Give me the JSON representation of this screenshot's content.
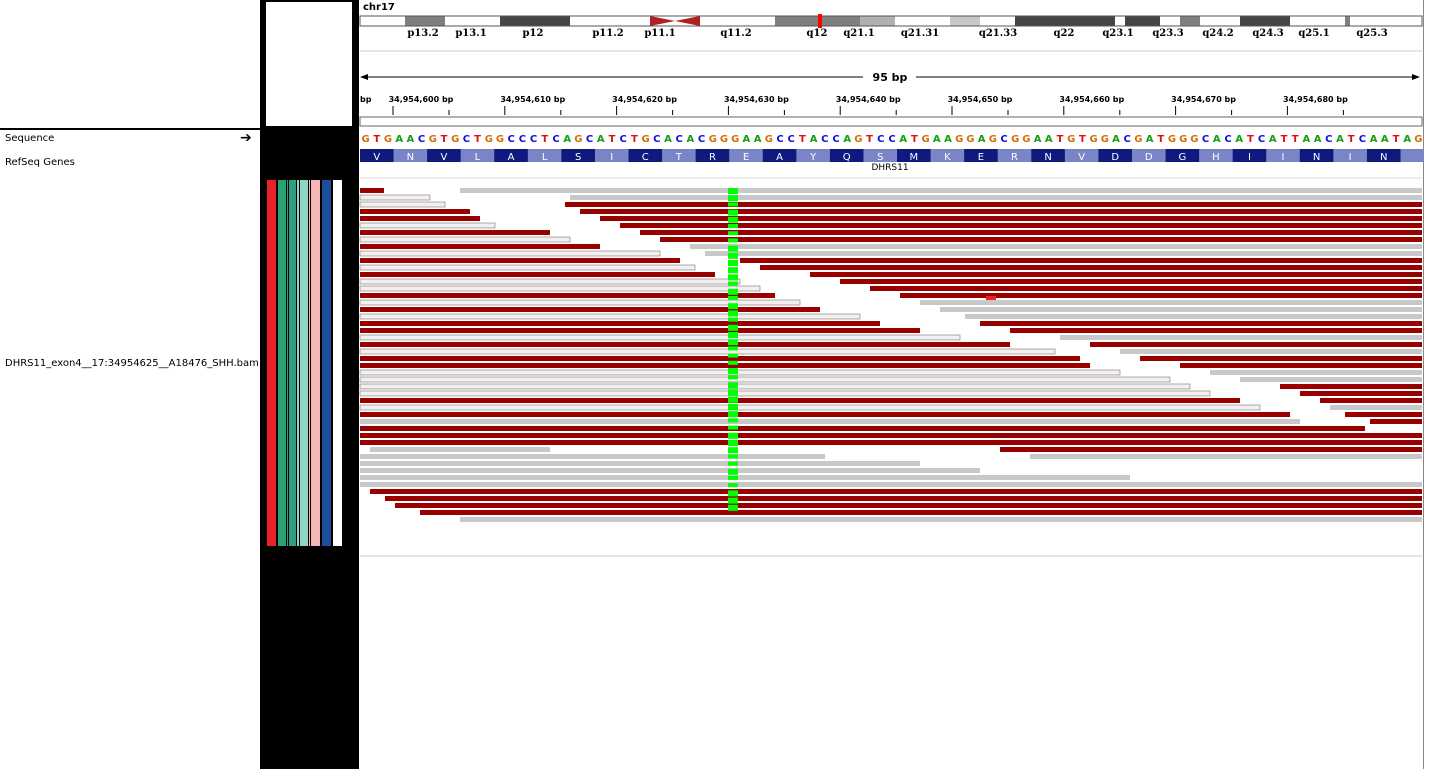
{
  "chromosome": "chr17",
  "ideogram": {
    "bands": [
      {
        "label": "p13.2"
      },
      {
        "label": "p13.1"
      },
      {
        "label": "p12"
      },
      {
        "label": "p11.2"
      },
      {
        "label": "p11.1"
      },
      {
        "label": "q11.2"
      },
      {
        "label": "q12"
      },
      {
        "label": "q21.1"
      },
      {
        "label": "q21.31"
      },
      {
        "label": "q21.33"
      },
      {
        "label": "q22"
      },
      {
        "label": "q23.1"
      },
      {
        "label": "q23.3"
      },
      {
        "label": "q24.2"
      },
      {
        "label": "q24.3"
      },
      {
        "label": "q25.1"
      },
      {
        "label": "q25.3"
      }
    ]
  },
  "ruler": {
    "span_label": "95 bp",
    "left_edge_label": "bp",
    "ticks": [
      "34,954,600 bp",
      "34,954,610 bp",
      "34,954,620 bp",
      "34,954,630 bp",
      "34,954,640 bp",
      "34,954,650 bp",
      "34,954,660 bp",
      "34,954,670 bp",
      "34,954,680 bp"
    ]
  },
  "tracks": {
    "sequence_label": "Sequence",
    "refseq_label": "RefSeq Genes",
    "bam_label": "DHRS11_exon4__17:34954625__A18476_SHH.bam"
  },
  "sequence": "GTGAACGTGCTGGCCCTCAGCATCTGCACACGGGAAGCCTACCAGTCCATGAAGGAGCGGAATGTGGACGATGGGCACATCATTAACATCAATAG",
  "translation": [
    "V",
    "N",
    "V",
    "L",
    "A",
    "L",
    "S",
    "I",
    "C",
    "T",
    "R",
    "E",
    "A",
    "Y",
    "Q",
    "S",
    "M",
    "K",
    "E",
    "R",
    "N",
    "V",
    "D",
    "D",
    "G",
    "H",
    "I",
    "I",
    "N",
    "I",
    "N"
  ],
  "gene_name": "DHRS11",
  "colors": {
    "base_A": "#11a011",
    "base_C": "#1010e0",
    "base_G": "#d17105",
    "base_T": "#e01010",
    "read_red": "#990000",
    "read_gray": "#c8c8c8",
    "mismatch_green": "#00ff00",
    "amino_dark": "#0f197e",
    "amino_light": "#7a84c6",
    "attr_strip": [
      "#e8212b",
      "#2aa273",
      "#2f9e84",
      "#90d4c3",
      "#f4b6b6",
      "#1b4f9c",
      "#ffffff"
    ]
  }
}
